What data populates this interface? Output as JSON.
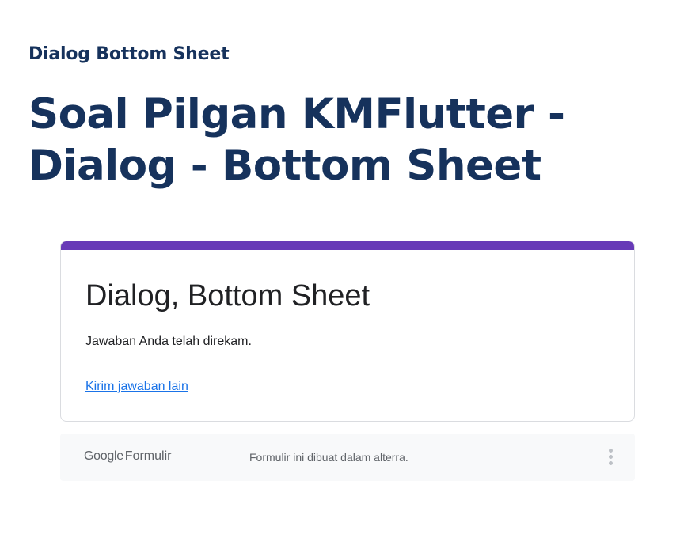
{
  "header": {
    "subtitle": "Dialog Bottom Sheet",
    "title": "Soal Pilgan KMFlutter - Dialog - Bottom Sheet"
  },
  "form": {
    "accent_color": "#673ab7",
    "title": "Dialog, Bottom Sheet",
    "confirmation_message": "Jawaban Anda telah direkam.",
    "submit_another_link": "Kirim jawaban lain"
  },
  "footer": {
    "logo_brand": "Google",
    "logo_product": "Formulir",
    "note": "Formulir ini dibuat dalam alterra.",
    "more_icon": "more-vertical-icon"
  }
}
